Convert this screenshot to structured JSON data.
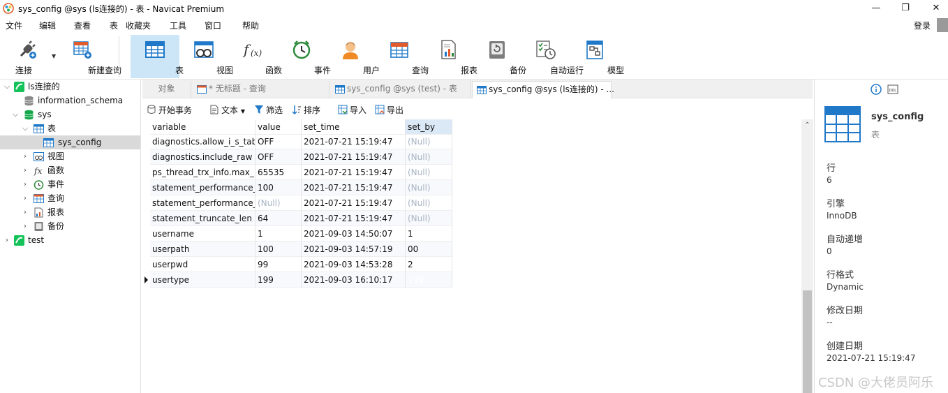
{
  "window": {
    "title": "sys_config @sys (ls连接的) - 表 - Navicat Premium",
    "minimize": "—",
    "restore": "❐",
    "close": "✕"
  },
  "menu": {
    "items": [
      "文件",
      "编辑",
      "查看",
      "表",
      "收藏夹",
      "工具",
      "窗口",
      "帮助"
    ],
    "login": "登录"
  },
  "toolbar": {
    "items": [
      {
        "label": "连接",
        "icon": "plug-icon"
      },
      {
        "label": "新建查询",
        "icon": "new-query-icon"
      },
      {
        "label": "表",
        "icon": "table-icon"
      },
      {
        "label": "视图",
        "icon": "view-icon"
      },
      {
        "label": "函数",
        "icon": "function-icon"
      },
      {
        "label": "事件",
        "icon": "event-clock-icon"
      },
      {
        "label": "用户",
        "icon": "user-icon"
      },
      {
        "label": "查询",
        "icon": "query-icon"
      },
      {
        "label": "报表",
        "icon": "report-icon"
      },
      {
        "label": "备份",
        "icon": "backup-icon"
      },
      {
        "label": "自动运行",
        "icon": "auto-run-icon"
      },
      {
        "label": "模型",
        "icon": "model-icon"
      }
    ]
  },
  "tree": {
    "connection": "ls连接的",
    "db1": "information_schema",
    "db2": "sys",
    "tables": "表",
    "selected_table": "sys_config",
    "views": "视图",
    "functions": "函数",
    "events": "事件",
    "queries": "查询",
    "reports": "报表",
    "backups": "备份",
    "connection2": "test"
  },
  "tabs": {
    "objects": "对象",
    "untitled": "* 无标题 - 查询",
    "test_tab": "sys_config @sys (test) - 表",
    "active_tab": "sys_config @sys (ls连接的) - ..."
  },
  "subbar": {
    "begin_tx": "开始事务",
    "text": "文本",
    "filter": "筛选",
    "sort": "排序",
    "import": "导入",
    "export": "导出"
  },
  "grid": {
    "columns": [
      "variable",
      "value",
      "set_time",
      "set_by"
    ],
    "null_text": "(Null)",
    "rows": [
      {
        "variable": "diagnostics.allow_i_s_tables",
        "value": "OFF",
        "set_time": "2021-07-21 15:19:47",
        "set_by": "(Null)"
      },
      {
        "variable": "diagnostics.include_raw",
        "value": "OFF",
        "set_time": "2021-07-21 15:19:47",
        "set_by": "(Null)"
      },
      {
        "variable": "ps_thread_trx_info.max_length",
        "value": "65535",
        "set_time": "2021-07-21 15:19:47",
        "set_by": "(Null)"
      },
      {
        "variable": "statement_performance_analyzer.limit",
        "value": "100",
        "set_time": "2021-07-21 15:19:47",
        "set_by": "(Null)"
      },
      {
        "variable": "statement_performance_analyzer.view",
        "value": "(Null)",
        "set_time": "2021-07-21 15:19:47",
        "set_by": "(Null)"
      },
      {
        "variable": "statement_truncate_len",
        "value": "64",
        "set_time": "2021-07-21 15:19:47",
        "set_by": "(Null)"
      },
      {
        "variable": "username",
        "value": "1",
        "set_time": "2021-09-03 14:50:07",
        "set_by": "1"
      },
      {
        "variable": "userpath",
        "value": "100",
        "set_time": "2021-09-03 14:57:19",
        "set_by": "00"
      },
      {
        "variable": "userpwd",
        "value": "99",
        "set_time": "2021-09-03 14:53:28",
        "set_by": "2"
      },
      {
        "variable": "usertype",
        "value": "199",
        "set_time": "2021-09-03 16:10:17",
        "set_by": "199"
      }
    ]
  },
  "info": {
    "name": "sys_config",
    "type": "表",
    "rows_label": "行",
    "rows_value": "6",
    "engine_label": "引擎",
    "engine_value": "InnoDB",
    "autoinc_label": "自动递增",
    "autoinc_value": "0",
    "rowformat_label": "行格式",
    "rowformat_value": "Dynamic",
    "modified_label": "修改日期",
    "modified_value": "--",
    "created_label": "创建日期",
    "created_value": "2021-07-21 15:19:47",
    "ddl_label": "DDL"
  },
  "watermark": "CSDN @大佬员阿乐",
  "colors": {
    "accent": "#1b74c9",
    "active_toolbar": "#cde6f7",
    "null_text": "#a8b4c4",
    "brand_green": "#14c25a"
  }
}
